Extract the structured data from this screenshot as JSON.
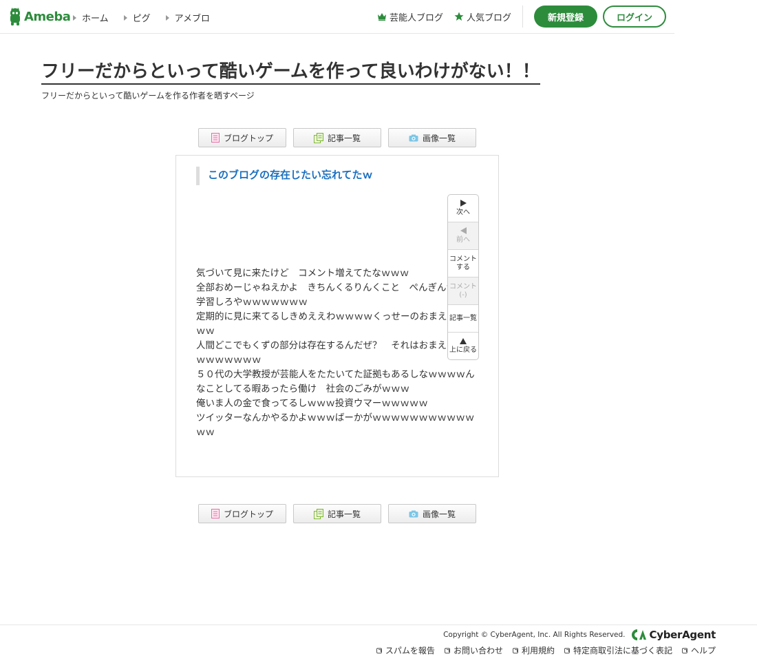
{
  "header": {
    "logo_text": "Ameba",
    "nav": [
      {
        "label": "ホーム"
      },
      {
        "label": "ピグ"
      },
      {
        "label": "アメブロ"
      }
    ],
    "celebrity_blog": "芸能人ブログ",
    "popular_blog": "人気ブログ",
    "signup": "新規登録",
    "login": "ログイン",
    "brand_color": "#2d8c3c"
  },
  "blog": {
    "title": "フリーだからといって酷いゲームを作って良いわけがない！！",
    "description": "フリーだからといって酷いゲームを作る作者を晒すページ"
  },
  "tabs": [
    {
      "label": "ブログトップ",
      "icon": "blog-top-icon"
    },
    {
      "label": "記事一覧",
      "icon": "entry-list-icon"
    },
    {
      "label": "画像一覧",
      "icon": "camera-icon"
    }
  ],
  "entry": {
    "title": "このブログの存在じたい忘れてたｗ",
    "title_color": "#1a6fbf",
    "lines": [
      "気づいて見に来たけど　コメント増えてたなｗｗｗ",
      "全部おめーじゃねえかよ　きちんくるりんくこと　ぺんぎんｗｗｗ学習しろやｗｗｗｗｗｗｗ",
      "定期的に見に来てるしきめええわｗｗｗｗくっせーのおまえｗｗｗｗｗ",
      "人間どこでもくずの部分は存在するんだぜ？　それはおまえにもｗｗｗｗｗｗｗｗ",
      "５０代の大学教授が芸能人をたたいてた証拠もあるしなｗｗｗｗんなことしてる暇あったら働け　社会のごみがｗｗｗ",
      "俺いま人の金で食ってるしｗｗｗ投資ウマーｗｗｗｗｗ",
      "ツイッターなんかやるかよｗｗｗばーかがｗｗｗｗｗｗｗｗｗｗｗｗｗ"
    ]
  },
  "side_nav": {
    "next": "次へ",
    "prev": "前へ",
    "comment_line1": "コメント",
    "comment_line2": "する",
    "comments_line1": "コメント",
    "comments_line2": "(-)",
    "entry_list": "記事一覧",
    "to_top": "上に戻る"
  },
  "footer": {
    "copyright": "Copyright © CyberAgent, Inc. All Rights Reserved.",
    "company_logo_text": "CyberAgent",
    "links": [
      {
        "label": "スパムを報告"
      },
      {
        "label": "お問い合わせ"
      },
      {
        "label": "利用規約"
      },
      {
        "label": "特定商取引法に基づく表記"
      },
      {
        "label": "ヘルプ"
      }
    ]
  }
}
